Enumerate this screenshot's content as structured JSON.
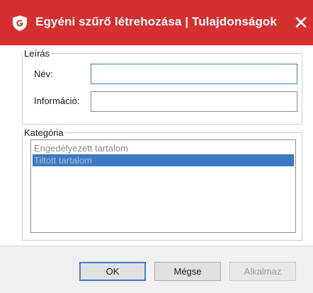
{
  "window": {
    "title": "Egyéni szűrő létrehozása | Tulajdonságok",
    "close_glyph": "✕",
    "titlebar_color": "#d5302f",
    "logo_icon": "g-data-shield-icon"
  },
  "description_group": {
    "legend": "Leírás",
    "name_label": "Név:",
    "name_value": "",
    "info_label": "Információ:",
    "info_value": ""
  },
  "category_group": {
    "legend": "Kategória",
    "items": [
      {
        "label": "Engedélyezett tartalom",
        "selected": false
      },
      {
        "label": "Tiltott tartalom",
        "selected": true
      }
    ],
    "selection_color": "#3d7ac4"
  },
  "buttons": {
    "ok": "OK",
    "cancel": "Mégse",
    "apply": "Alkalmaz",
    "apply_enabled": false
  }
}
